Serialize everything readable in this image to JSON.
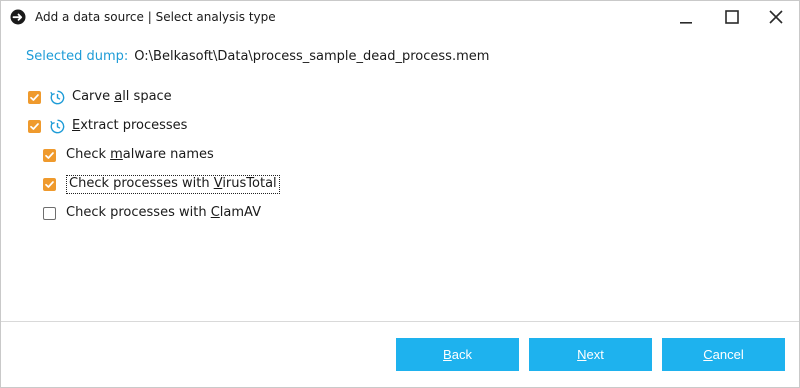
{
  "window": {
    "title": "Add a data source | Select analysis type",
    "controls": {
      "minimize_icon": "minimize-icon",
      "maximize_icon": "maximize-icon",
      "close_icon": "close-icon"
    }
  },
  "dump": {
    "label": "Selected dump:",
    "path": "O:\\Belkasoft\\Data\\process_sample_dead_process.mem"
  },
  "options": [
    {
      "pre": "Carve ",
      "ul": "a",
      "post": "ll space",
      "checked": true,
      "icon": "clock-icon"
    },
    {
      "pre": "",
      "ul": "E",
      "post": "xtract processes",
      "checked": true,
      "icon": "clock-icon"
    }
  ],
  "sub_options": [
    {
      "pre": "Check ",
      "ul": "m",
      "post": "alware names",
      "checked": true
    },
    {
      "pre": "Check processes with ",
      "ul": "V",
      "post": "irusTotal",
      "checked": true,
      "focused": true
    },
    {
      "pre": "Check processes with ",
      "ul": "C",
      "post": "lamAV",
      "checked": false
    }
  ],
  "buttons": {
    "back": {
      "ul": "B",
      "post": "ack"
    },
    "next": {
      "ul": "N",
      "post": "ext"
    },
    "cancel": {
      "ul": "C",
      "post": "ancel"
    }
  },
  "colors": {
    "accent": "#1eb2ee",
    "label_blue": "#1e9cd7",
    "checkbox": "#ef9a2d"
  }
}
